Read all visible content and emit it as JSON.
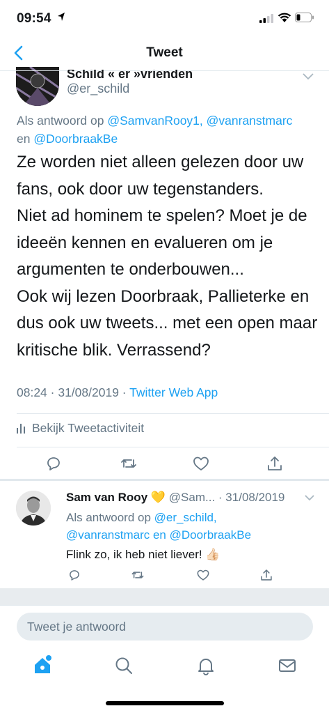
{
  "status_bar": {
    "time": "09:54"
  },
  "nav": {
    "title": "Tweet"
  },
  "main_tweet": {
    "name": "Schild « er »vrienden",
    "handle": "@er_schild",
    "reply_prefix": "Als antwoord op ",
    "reply_mentions": "@SamvanRooy1, @vanranstmarc",
    "reply_and": "en ",
    "reply_last": "@DoorbraakBe",
    "text": "Ze worden niet alleen gelezen door uw fans, ook door uw tegenstanders.\nNiet ad hominem te spelen? Moet je de ideeën kennen en evalueren om je argumenten te onderbouwen...\nOok wij lezen Doorbraak, Pallieterke en dus ook uw tweets... met een open maar kritische blik. Verrassend?",
    "time_date": "08:24 · 31/08/2019 · ",
    "source": "Twitter Web App",
    "activity_label": "Bekijk Tweetactiviteit"
  },
  "reply_tweet": {
    "name": "Sam van Rooy",
    "badge": "💛",
    "handle": "@Sam...",
    "date": "· 31/08/2019",
    "reply_prefix": "Als antwoord op ",
    "reply_m1": "@er_schild,",
    "reply_m2": "@vanranstmarc",
    "reply_and": " en ",
    "reply_m3": "@DoorbraakBe",
    "text": "Flink zo, ik heb niet liever! 👍🏻"
  },
  "compose": {
    "placeholder": "Tweet je antwoord"
  },
  "colors": {
    "accent": "#1da1f2",
    "secondary_text": "#657786",
    "divider": "#e1e8ed"
  },
  "icons": [
    "back-icon",
    "reply-icon",
    "retweet-icon",
    "like-icon",
    "share-icon",
    "home-icon",
    "search-icon",
    "notifications-icon",
    "messages-icon"
  ]
}
